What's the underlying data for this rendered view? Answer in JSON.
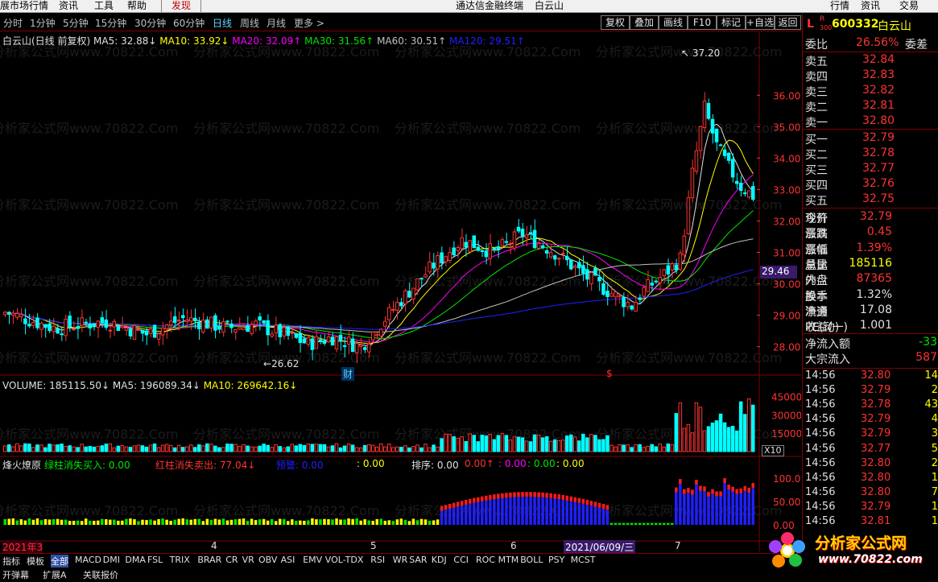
{
  "menu": {
    "items": [
      "展市场行情",
      "资讯",
      "工具",
      "帮助",
      "发现"
    ],
    "center": "通达信金融终端",
    "center_stock": "白云山",
    "right": [
      "行情",
      "资讯",
      "交易"
    ]
  },
  "periods": [
    "分时",
    "1分钟",
    "5分钟",
    "15分钟",
    "30分钟",
    "60分钟",
    "日线",
    "周线",
    "月线",
    "更多 >"
  ],
  "selected_period": "日线",
  "toolbar": [
    "复权",
    "叠加",
    "画线",
    "F10",
    "标记",
    "+自选",
    "返回"
  ],
  "stock": {
    "title": "白云山(日线 前复权)",
    "code": "600332",
    "name": "白云山",
    "flag_l": "L",
    "flag_r": "R",
    "flag_300": "300"
  },
  "ma_labels": [
    {
      "text": "MA5: 32.88↓",
      "color": "#e0e0e0"
    },
    {
      "text": "MA10: 33.92↓",
      "color": "#ffff00"
    },
    {
      "text": "MA20: 32.09↑",
      "color": "#ff00ff"
    },
    {
      "text": "MA30: 31.56↑",
      "color": "#00e600"
    },
    {
      "text": "MA60: 30.51↑",
      "color": "#c0c0c0"
    },
    {
      "text": "MA120: 29.51↑",
      "color": "#2020ff"
    }
  ],
  "price_axis": [
    "36.00",
    "35.00",
    "34.00",
    "33.00",
    "32.00",
    "31.00",
    "30.00",
    "29.00",
    "28.00"
  ],
  "price_tag": "29.46",
  "high_label": "37.20",
  "low_label": "26.62",
  "markers": {
    "cai": "财",
    "s": "$"
  },
  "volume": {
    "labels": [
      {
        "text": "VOLUME: 185115.50↓",
        "color": "#e0e0e0"
      },
      {
        "text": "MA5: 196089.34↓",
        "color": "#e0e0e0"
      },
      {
        "text": "MA10: 269642.16↓",
        "color": "#ffff00"
      }
    ],
    "axis": [
      "45000",
      "30000",
      "15000"
    ],
    "unit": "X10"
  },
  "indicator": {
    "labels": [
      {
        "text": "烽火燎原",
        "color": "#e0e0e0"
      },
      {
        "text": "绿柱消失买入: 0.00",
        "color": "#00e600"
      },
      {
        "text": "红柱消失卖出: 77.04↓",
        "color": "#ff3232"
      },
      {
        "text": "预警: 0.00",
        "color": "#2020ff"
      },
      {
        "text": ": 0.00",
        "color": "#ffff00"
      },
      {
        "text": "排序: 0.00",
        "color": "#e0e0e0"
      },
      {
        "text": "0.00↑",
        "color": "#ff3232"
      },
      {
        "text": ": 0.00",
        "color": "#ff00ff"
      },
      {
        "text": ": 0.00",
        "color": "#00e600"
      },
      {
        "text": ": 0.00",
        "color": "#ffff00"
      }
    ],
    "axis": [
      "100.00",
      "50.00",
      "0.00"
    ]
  },
  "dates": {
    "y2021_3": "2021年3",
    "m4": "4",
    "m5": "5",
    "m6": "6",
    "m7": "7",
    "cursor": "2021/06/09/三"
  },
  "quote": {
    "wei_bi": "委比",
    "wei_bi_val": "26.56%",
    "wei_cha": "委差",
    "sells": [
      {
        "label": "卖五",
        "price": "32.84"
      },
      {
        "label": "卖四",
        "price": "32.83"
      },
      {
        "label": "卖三",
        "price": "32.82"
      },
      {
        "label": "卖二",
        "price": "32.81"
      },
      {
        "label": "卖一",
        "price": "32.80"
      }
    ],
    "buys": [
      {
        "label": "买一",
        "price": "32.79"
      },
      {
        "label": "买二",
        "price": "32.78"
      },
      {
        "label": "买三",
        "price": "32.77"
      },
      {
        "label": "买四",
        "price": "32.76"
      },
      {
        "label": "买五",
        "price": "32.75"
      }
    ],
    "stats": [
      {
        "l": "现价",
        "v": "32.79",
        "vc": "red",
        "r": "今开"
      },
      {
        "l": "涨跌",
        "v": "0.45",
        "vc": "red",
        "r": "最高"
      },
      {
        "l": "涨幅",
        "v": "1.39%",
        "vc": "red",
        "r": "最低"
      },
      {
        "l": "总量",
        "v": "185116",
        "vc": "yel",
        "r": "量比"
      },
      {
        "l": "外盘",
        "v": "87365",
        "vc": "red",
        "r": "内盘"
      },
      {
        "l": "换手",
        "v": "1.32%",
        "vc": "wht",
        "r": "股本"
      },
      {
        "l": "净资",
        "v": "17.08",
        "vc": "wht",
        "r": "流通"
      },
      {
        "l": "收益(一)",
        "v": "1.001",
        "vc": "wht",
        "r": "PE(动)"
      }
    ],
    "flow": [
      {
        "l": "净流入额",
        "v": "-33",
        "vc": "grn"
      },
      {
        "l": "大宗流入",
        "v": "587",
        "vc": "red"
      }
    ],
    "ticks": [
      {
        "t": "14:56",
        "p": "32.80",
        "v": "14"
      },
      {
        "t": "14:56",
        "p": "32.79",
        "v": "2"
      },
      {
        "t": "14:56",
        "p": "32.78",
        "v": "43"
      },
      {
        "t": "14:56",
        "p": "32.79",
        "v": "4"
      },
      {
        "t": "14:56",
        "p": "32.79",
        "v": "3"
      },
      {
        "t": "14:56",
        "p": "32.77",
        "v": "5"
      },
      {
        "t": "14:56",
        "p": "32.80",
        "v": "2"
      },
      {
        "t": "14:56",
        "p": "32.80",
        "v": "1"
      },
      {
        "t": "14:56",
        "p": "32.80",
        "v": "7"
      },
      {
        "t": "14:56",
        "p": "32.79",
        "v": "1"
      },
      {
        "t": "14:56",
        "p": "32.81",
        "v": "1"
      }
    ]
  },
  "bottom_tabs": [
    "指标",
    "模板",
    "全部",
    "MACD",
    "DMI",
    "DMA",
    "FSL",
    "TRIX",
    "BRAR",
    "CR",
    "VR",
    "OBV",
    "ASI",
    "EMV",
    "VOL-TDX",
    "RSI",
    "WR",
    "SAR",
    "KDJ",
    "CCI",
    "ROC",
    "MTM",
    "BOLL",
    "PSY",
    "MCST"
  ],
  "bottom_tabs2": [
    "开弹幕",
    "扩展A",
    "关联报价"
  ],
  "watermark": "分析家公式网www.70822.Com",
  "logo": {
    "cn": "分析家公式网",
    "url": "www.70822.com"
  },
  "colors": {
    "up": "#ff3232",
    "down": "#00ffff",
    "ma5": "#e0e0e0",
    "ma10": "#ffff00",
    "ma20": "#ff00ff",
    "ma30": "#00e600",
    "ma60": "#c0c0c0",
    "ma120": "#2020ff"
  },
  "chart_data": {
    "type": "candlestick",
    "note": "daily K-line with volume and indicator panes",
    "ylim": [
      27.3,
      37.8
    ],
    "high": 37.2,
    "low": 26.62
  }
}
